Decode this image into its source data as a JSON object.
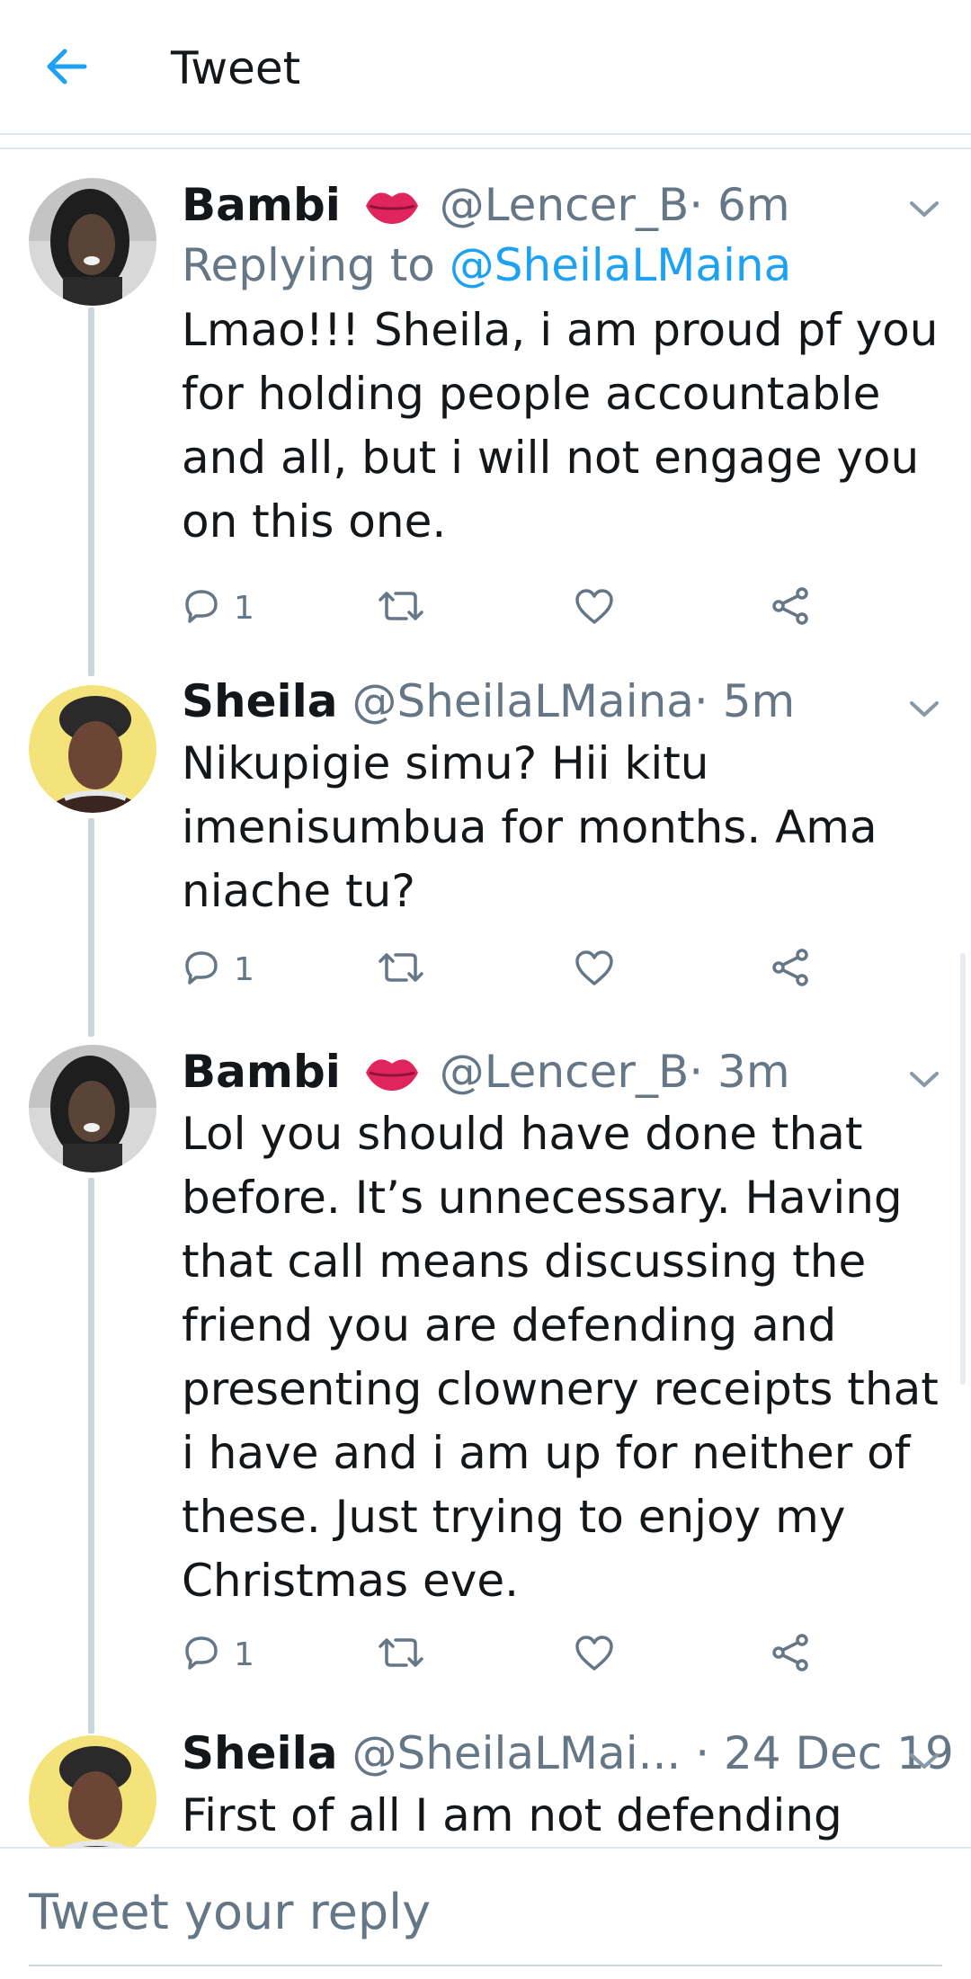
{
  "header": {
    "title": "Tweet"
  },
  "tweets": [
    {
      "name": "Bambi",
      "handle": "@Lencer_B",
      "time": "· 6m",
      "replying_prefix": "Replying to ",
      "replying_to": "@SheilaLMaina",
      "text": "Lmao!!! Sheila, i am proud pf you for holding people accountable and all, but i will not engage you on this one.",
      "reply_count": "1"
    },
    {
      "name": "Sheila",
      "handle": "@SheilaLMaina",
      "time": "· 5m",
      "text": "Nikupigie simu? Hii kitu imenisumbua for months. Ama niache tu?",
      "reply_count": "1"
    },
    {
      "name": "Bambi",
      "handle": "@Lencer_B",
      "time": "· 3m",
      "text": "Lol you should have done that before. It’s unnecessary. Having that call means discussing the friend you are defending and presenting clownery receipts that i have and i am up for neither of these. Just trying to enjoy my Christmas eve.",
      "reply_count": "1"
    },
    {
      "name": "Sheila",
      "handle": "@SheilaLMai...",
      "time": "· 24 Dec 19",
      "text": "First of all I am not defending"
    }
  ],
  "composer": {
    "placeholder": "Tweet your reply"
  },
  "colors": {
    "accent": "#1da1f2",
    "secondary_text": "#657786",
    "thread_line": "#ccd6dd",
    "lips": "#e0245e"
  }
}
